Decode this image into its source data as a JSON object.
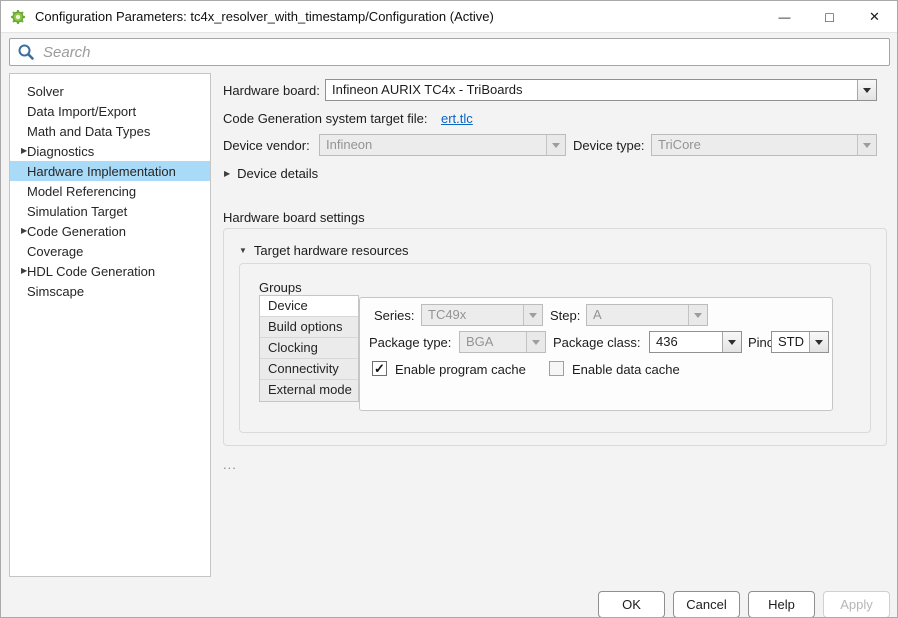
{
  "window": {
    "title": "Configuration Parameters: tc4x_resolver_with_timestamp/Configuration (Active)",
    "controls": {
      "minimize": "—",
      "maximize": "□",
      "close": "✕"
    }
  },
  "icons": {
    "collapsed": "▶",
    "expanded": "▼"
  },
  "search": {
    "placeholder": "Search"
  },
  "sidebar": {
    "items": [
      {
        "label": "Solver"
      },
      {
        "label": "Data Import/Export"
      },
      {
        "label": "Math and Data Types"
      },
      {
        "label": "Diagnostics",
        "expandable": true
      },
      {
        "label": "Hardware Implementation",
        "selected": true
      },
      {
        "label": "Model Referencing"
      },
      {
        "label": "Simulation Target"
      },
      {
        "label": "Code Generation",
        "expandable": true
      },
      {
        "label": "Coverage"
      },
      {
        "label": "HDL Code Generation",
        "expandable": true
      },
      {
        "label": "Simscape"
      }
    ]
  },
  "main": {
    "hardware_board": {
      "label": "Hardware board:",
      "value": "Infineon AURIX TC4x - TriBoards"
    },
    "target_file": {
      "label": "Code Generation system target file:",
      "link": "ert.tlc"
    },
    "device_vendor": {
      "label": "Device vendor:",
      "value": "Infineon",
      "disabled": true
    },
    "device_type": {
      "label": "Device type:",
      "value": "TriCore",
      "disabled": true
    },
    "device_details": {
      "label": "Device details"
    },
    "board_settings": {
      "heading": "Hardware board settings",
      "section": "Target hardware resources",
      "groups_label": "Groups",
      "groups": [
        {
          "label": "Device",
          "selected": true
        },
        {
          "label": "Build options"
        },
        {
          "label": "Clocking"
        },
        {
          "label": "Connectivity"
        },
        {
          "label": "External mode"
        }
      ],
      "device_group": {
        "series": {
          "label": "Series:",
          "value": "TC49x",
          "disabled": true
        },
        "step": {
          "label": "Step:",
          "value": "A",
          "disabled": true
        },
        "package_type": {
          "label": "Package type:",
          "value": "BGA",
          "disabled": true
        },
        "package_class": {
          "label": "Package class:",
          "value": "436",
          "disabled": false
        },
        "pinout": {
          "label": "Pinout:",
          "value": "STD",
          "disabled": false
        },
        "program_cache": {
          "label": "Enable program cache",
          "checked": true
        },
        "data_cache": {
          "label": "Enable data cache",
          "checked": false
        }
      }
    },
    "ellipsis": "..."
  },
  "footer": {
    "ok": "OK",
    "cancel": "Cancel",
    "help": "Help",
    "apply": "Apply"
  }
}
